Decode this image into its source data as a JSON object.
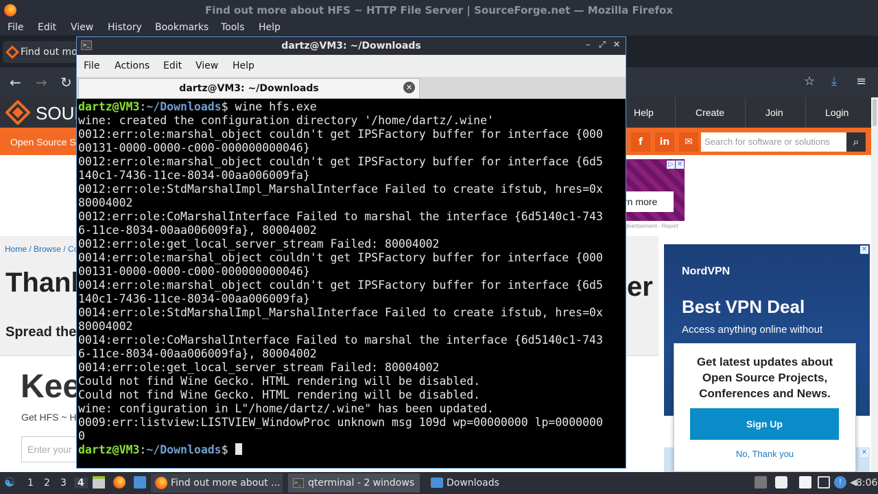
{
  "firefox": {
    "window_title": "Find out more about HFS ~ HTTP File Server | SourceForge.net — Mozilla Firefox",
    "menu": [
      "File",
      "Edit",
      "View",
      "History",
      "Bookmarks",
      "Tools",
      "Help"
    ],
    "tab_label": "Find out mo"
  },
  "webpage": {
    "logo_text": "SOUR",
    "nav": [
      "Help",
      "Create",
      "Join",
      "Login"
    ],
    "orange_bar_text": "Open Source So",
    "social": [
      "f",
      "in",
      "✉"
    ],
    "search_placeholder": "Search for software or solutions",
    "ad_learn": "rn more",
    "ad_caption": "dvertisement - Report",
    "breadcrumb": "Home / Browse / Co",
    "headline_left": "Thank",
    "headline_right": "er",
    "spread": "Spread the W",
    "keep": "Kee",
    "get_hfs": "Get HFS ~ H",
    "email_placeholder": "Enter your",
    "nordvpn": {
      "logo": "NordVPN",
      "deal": "Best VPN Deal",
      "access": "Access anything online without"
    },
    "popup": {
      "text": "Get latest updates about Open Source Projects, Conferences and News.",
      "signup": "Sign Up",
      "no_thanks": "No, Thank you"
    }
  },
  "terminal": {
    "window_title": "dartz@VM3: ~/Downloads",
    "menu": [
      "File",
      "Actions",
      "Edit",
      "View",
      "Help"
    ],
    "tab_title": "dartz@VM3: ~/Downloads",
    "prompt_user": "dartz@VM3",
    "prompt_path": "~/Downloads",
    "command": " wine hfs.exe",
    "lines": [
      "wine: created the configuration directory '/home/dartz/.wine'",
      "0012:err:ole:marshal_object couldn't get IPSFactory buffer for interface {000",
      "00131-0000-0000-c000-000000000046}",
      "0012:err:ole:marshal_object couldn't get IPSFactory buffer for interface {6d5",
      "140c1-7436-11ce-8034-00aa006009fa}",
      "0012:err:ole:StdMarshalImpl_MarshalInterface Failed to create ifstub, hres=0x",
      "80004002",
      "0012:err:ole:CoMarshalInterface Failed to marshal the interface {6d5140c1-743",
      "6-11ce-8034-00aa006009fa}, 80004002",
      "0012:err:ole:get_local_server_stream Failed: 80004002",
      "0014:err:ole:marshal_object couldn't get IPSFactory buffer for interface {000",
      "00131-0000-0000-c000-000000000046}",
      "0014:err:ole:marshal_object couldn't get IPSFactory buffer for interface {6d5",
      "140c1-7436-11ce-8034-00aa006009fa}",
      "0014:err:ole:StdMarshalImpl_MarshalInterface Failed to create ifstub, hres=0x",
      "80004002",
      "0014:err:ole:CoMarshalInterface Failed to marshal the interface {6d5140c1-743",
      "6-11ce-8034-00aa006009fa}, 80004002",
      "0014:err:ole:get_local_server_stream Failed: 80004002",
      "Could not find Wine Gecko. HTML rendering will be disabled.",
      "Could not find Wine Gecko. HTML rendering will be disabled.",
      "wine: configuration in L\"/home/dartz/.wine\" has been updated.",
      "0009:err:listview:LISTVIEW_WindowProc unknown msg 109d wp=00000000 lp=0000000",
      "0"
    ]
  },
  "taskbar": {
    "workspaces": [
      "1",
      "2",
      "3",
      "4"
    ],
    "active_workspace": "4",
    "tasks": [
      "Find out more about ...",
      "qterminal - 2 windows",
      "Downloads"
    ],
    "clock": "8:06"
  },
  "colors": {
    "prompt_user": "#8ae234",
    "prompt_path": "#729fcf",
    "sf_orange": "#f26a24"
  }
}
